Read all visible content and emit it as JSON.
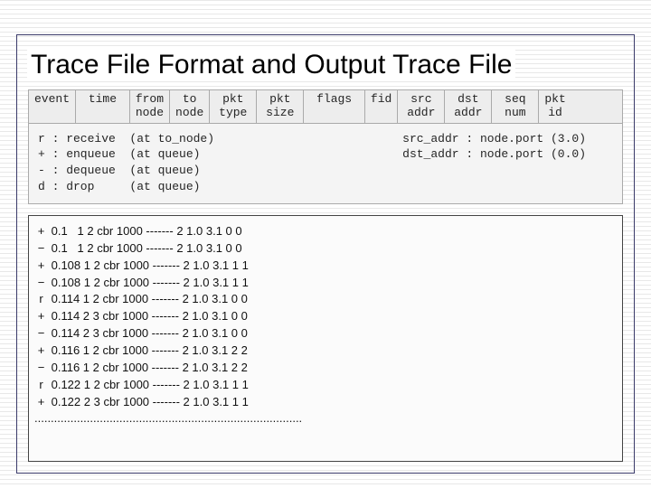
{
  "title": "Trace File Format and Output Trace File",
  "header_cells": [
    "event",
    " time ",
    "from\nnode",
    " to \nnode",
    " pkt \ntype",
    " pkt \nsize",
    " flags ",
    "fid",
    " src \naddr",
    " dst \naddr",
    " seq \nnum",
    "pkt\nid"
  ],
  "legend_left": "r : receive  (at to_node)\n+ : enqueue  (at queue)\n- : dequeue  (at queue)\nd : drop     (at queue)",
  "legend_right": "src_addr : node.port (3.0)\ndst_addr : node.port (0.0)",
  "trace_lines": [
    {
      "ev": "+",
      "rest": " 0.1   1 2 cbr 1000 ------- 2 1.0 3.1 0 0"
    },
    {
      "ev": "−",
      "rest": " 0.1   1 2 cbr 1000 ------- 2 1.0 3.1 0 0"
    },
    {
      "ev": "+",
      "rest": " 0.108 1 2 cbr 1000 ------- 2 1.0 3.1 1 1"
    },
    {
      "ev": "−",
      "rest": " 0.108 1 2 cbr 1000 ------- 2 1.0 3.1 1 1"
    },
    {
      "ev": "r",
      "rest": " 0.114 1 2 cbr 1000 ------- 2 1.0 3.1 0 0"
    },
    {
      "ev": "+",
      "rest": " 0.114 2 3 cbr 1000 ------- 2 1.0 3.1 0 0"
    },
    {
      "ev": "−",
      "rest": " 0.114 2 3 cbr 1000 ------- 2 1.0 3.1 0 0"
    },
    {
      "ev": "+",
      "rest": " 0.116 1 2 cbr 1000 ------- 2 1.0 3.1 2 2"
    },
    {
      "ev": "−",
      "rest": " 0.116 1 2 cbr 1000 ------- 2 1.0 3.1 2 2"
    },
    {
      "ev": "r",
      "rest": " 0.122 1 2 cbr 1000 ------- 2 1.0 3.1 1 1"
    },
    {
      "ev": "+",
      "rest": " 0.122 2 3 cbr 1000 ------- 2 1.0 3.1 1 1"
    }
  ],
  "dots": ".................................................................................."
}
